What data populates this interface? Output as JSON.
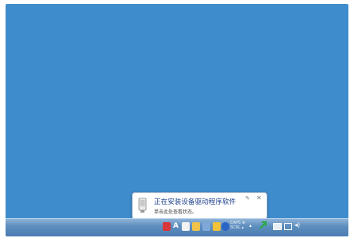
{
  "notification": {
    "title": "正在安装设备驱动程序软件",
    "subtitle": "单击此处查看状态。",
    "options_icon": "wrench-icon",
    "close_icon": "close-icon",
    "device_icon": "usb-device-icon"
  },
  "taskbar": {
    "tray_icons": [
      "red-app-icon",
      "ime-a-icon",
      "input-method-icon",
      "folder-icon",
      "network-icon",
      "help-icon",
      "show-hidden-icon",
      "flag-icon",
      "monitor-icon",
      "volume-icon"
    ],
    "clock_line1": "CAPS ⊕",
    "clock_line2": "SCRL ▴"
  },
  "colors": {
    "desktop": "#3f8ccd",
    "taskbar": "#5f8fbe",
    "balloon_title": "#1b3f8b"
  }
}
